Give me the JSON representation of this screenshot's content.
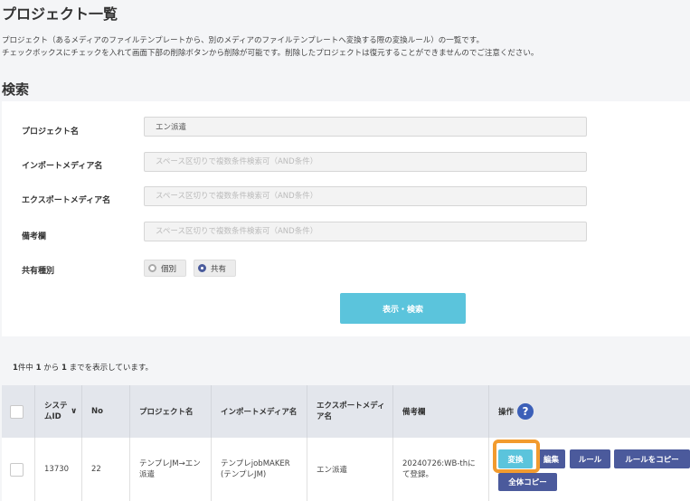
{
  "page": {
    "title": "プロジェクト一覧",
    "description_line1": "プロジェクト（あるメディアのファイルテンプレートから、別のメディアのファイルテンプレートへ変換する際の変換ルール）の一覧です。",
    "description_line2": "チェックボックスにチェックを入れて画面下部の削除ボタンから削除が可能です。削除したプロジェクトは復元することができませんのでご注意ください。"
  },
  "search": {
    "title": "検索",
    "project_name_label": "プロジェクト名",
    "project_name_value": "エン派遣",
    "import_media_label": "インポートメディア名",
    "import_media_placeholder": "スペース区切りで複数条件検索可（AND条件）",
    "export_media_label": "エクスポートメディア名",
    "export_media_placeholder": "スペース区切りで複数条件検索可（AND条件）",
    "notes_label": "備考欄",
    "notes_placeholder": "スペース区切りで複数条件検索可（AND条件）",
    "share_type_label": "共有種別",
    "share_options": [
      "個別",
      "共有"
    ],
    "share_selected": "共有",
    "submit_label": "表示・検索"
  },
  "results": {
    "count_prefix": "件中",
    "total": "1",
    "from": "1",
    "to": "1",
    "count_mid1": "から",
    "count_mid2": "までを表示しています。"
  },
  "table": {
    "headers": {
      "system_id": "システムID",
      "no": "No",
      "project_name": "プロジェクト名",
      "import_media": "インポートメディア名",
      "export_media": "エクスポートメディア名",
      "notes": "備考欄",
      "operations": "操作"
    },
    "rows": [
      {
        "system_id": "13730",
        "no": "22",
        "project_name": "テンプレJM→エン派遣",
        "import_media": "テンプレjobMAKER(テンプレJM)",
        "export_media": "エン派遣",
        "notes": "20240726:WB-thにて登録。",
        "actions": [
          "変換",
          "編集",
          "ルール",
          "ルールをコピー",
          "全体コピー"
        ]
      }
    ]
  },
  "colors": {
    "accent_cyan": "#5bc4dc",
    "accent_indigo": "#4b5a9c",
    "highlight_orange": "#f29b2e"
  }
}
